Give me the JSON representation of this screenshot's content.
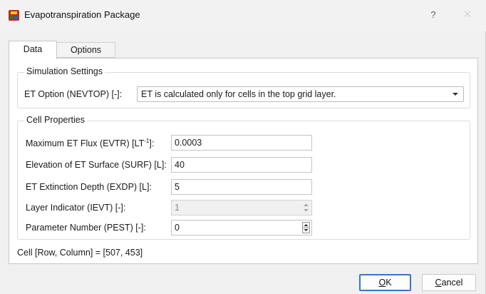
{
  "window": {
    "title": "Evapotranspiration Package",
    "help_label": "?",
    "close_label": "✕"
  },
  "tabs": [
    {
      "label": "Data",
      "active": true
    },
    {
      "label": "Options",
      "active": false
    }
  ],
  "simulation_settings": {
    "group_title": "Simulation Settings",
    "et_option_label": "ET Option (NEVTOP) [-]:",
    "et_option_value": "ET is calculated only for cells in the top grid layer."
  },
  "cell_properties": {
    "group_title": "Cell Properties",
    "fields": [
      {
        "label_pre": "Maximum ET Flux (EVTR) [LT",
        "label_sup": "-1",
        "label_post": "]:",
        "value": "0.0003",
        "enabled": true,
        "spinner": false
      },
      {
        "label": "Elevation of ET Surface (SURF) [L]:",
        "value": "40",
        "enabled": true,
        "spinner": false
      },
      {
        "label": "ET Extinction Depth (EXDP) [L]:",
        "value": "5",
        "enabled": true,
        "spinner": false
      },
      {
        "label": "Layer Indicator (IEVT) [-]:",
        "value": "1",
        "enabled": false,
        "spinner": true
      },
      {
        "label": "Parameter Number (PEST) [-]:",
        "value": "0",
        "enabled": true,
        "spinner": true
      }
    ]
  },
  "status": {
    "cell_text": "Cell [Row, Column] = [507, 453]"
  },
  "buttons": {
    "ok": {
      "mnemonic": "O",
      "rest": "K"
    },
    "cancel": {
      "mnemonic": "C",
      "rest": "ancel"
    }
  },
  "colors": {
    "accent": "#3b73c8",
    "app_icon_primary": "#c0281e",
    "app_icon_secondary": "#f2c21a"
  },
  "icons": {
    "app": "app-icon",
    "dropdown": "chevron-down-icon",
    "spinner": "spinner-arrows-icon"
  }
}
